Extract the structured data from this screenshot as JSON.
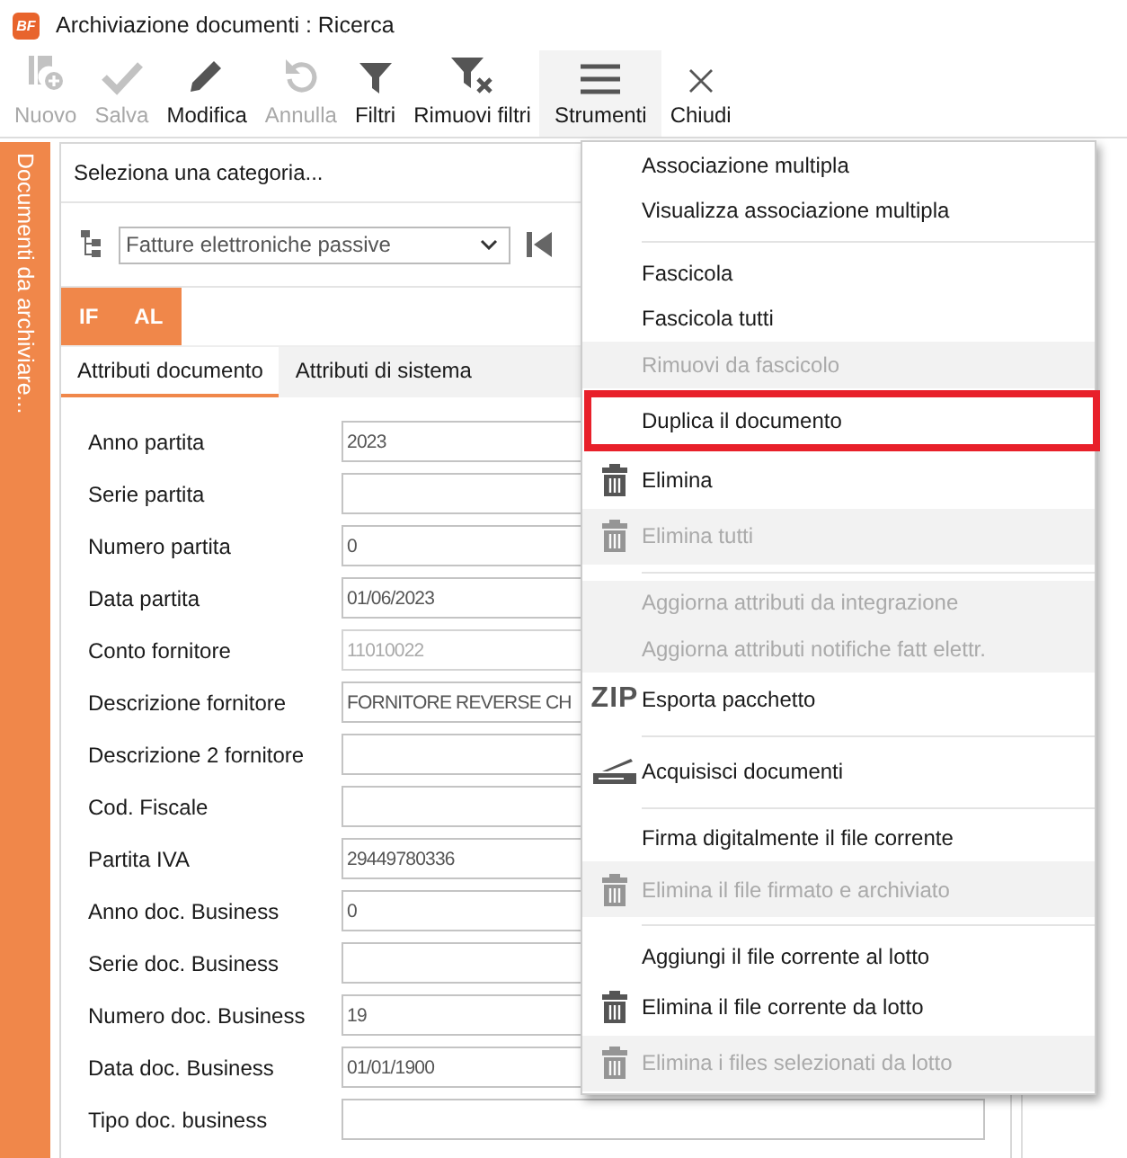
{
  "window": {
    "title": "Archiviazione documenti : Ricerca",
    "logo": "BF"
  },
  "toolbar": [
    {
      "label": "Nuovo",
      "kind": "new",
      "disabled": true,
      "selected": false
    },
    {
      "label": "Salva",
      "kind": "check",
      "disabled": true,
      "selected": false
    },
    {
      "label": "Modifica",
      "kind": "pencil",
      "disabled": false,
      "selected": false
    },
    {
      "label": "Annulla",
      "kind": "undo",
      "disabled": true,
      "selected": false
    },
    {
      "label": "Filtri",
      "kind": "filter",
      "disabled": false,
      "selected": false
    },
    {
      "label": "Rimuovi filtri",
      "kind": "filter-x",
      "disabled": false,
      "selected": false
    },
    {
      "label": "Strumenti",
      "kind": "menu",
      "disabled": false,
      "selected": true
    },
    {
      "label": "Chiudi",
      "kind": "close",
      "disabled": false,
      "selected": false
    }
  ],
  "side_panel": {
    "label": "Documenti da archiviare..."
  },
  "panel": {
    "header": "Seleziona una categoria...",
    "category": "Fatture elettroniche passive",
    "groups": [
      {
        "label": "IF"
      },
      {
        "label": "AL"
      }
    ],
    "tabs": [
      {
        "label": "Attributi documento",
        "selected": true
      },
      {
        "label": "Attributi di sistema",
        "selected": false
      }
    ],
    "fields": [
      {
        "label": "Anno partita",
        "value": "2023",
        "disabled": false
      },
      {
        "label": "Serie partita",
        "disabled": false
      },
      {
        "label": "Numero partita",
        "value": "0",
        "disabled": false
      },
      {
        "label": "Data partita",
        "value": "01/06/2023",
        "disabled": false
      },
      {
        "label": "Conto fornitore",
        "value": "11010022",
        "disabled": true
      },
      {
        "label": "Descrizione fornitore",
        "value": "FORNITORE REVERSE CH",
        "disabled": false
      },
      {
        "label": "Descrizione 2 fornitore",
        "disabled": false
      },
      {
        "label": "Cod. Fiscale",
        "disabled": false
      },
      {
        "label": "Partita IVA",
        "value": "29449780336",
        "disabled": false
      },
      {
        "label": "Anno doc. Business",
        "value": "0",
        "disabled": false
      },
      {
        "label": "Serie doc. Business",
        "disabled": false
      },
      {
        "label": "Numero doc. Business",
        "value": "19",
        "disabled": false
      },
      {
        "label": "Data doc. Business",
        "value": "01/01/1900",
        "disabled": false
      },
      {
        "label": "Tipo doc. business",
        "disabled": false
      }
    ]
  },
  "menu": [
    {
      "kind": "item",
      "label": "Associazione multipla",
      "disabled": false,
      "highlighted": false
    },
    {
      "kind": "item",
      "label": "Visualizza associazione multipla",
      "disabled": false,
      "highlighted": false
    },
    {
      "kind": "separator"
    },
    {
      "kind": "item",
      "label": "Fascicola",
      "disabled": false,
      "highlighted": false
    },
    {
      "kind": "item",
      "label": "Fascicola tutti",
      "disabled": false,
      "highlighted": false
    },
    {
      "kind": "item",
      "label": "Rimuovi da fascicolo",
      "disabled": true,
      "highlighted": false
    },
    {
      "kind": "item",
      "label": "Duplica il documento",
      "disabled": false,
      "highlighted": true
    },
    {
      "kind": "trash",
      "label": "Elimina",
      "disabled": false,
      "highlighted": false
    },
    {
      "kind": "trash",
      "label": "Elimina tutti",
      "disabled": true,
      "highlighted": false
    },
    {
      "kind": "separator"
    },
    {
      "kind": "item",
      "label": "Aggiorna attributi da integrazione",
      "disabled": true,
      "highlighted": false
    },
    {
      "kind": "item",
      "label": "Aggiorna attributi notifiche fatt elettr.",
      "disabled": true,
      "highlighted": false
    },
    {
      "kind": "zip",
      "label": "Esporta pacchetto",
      "icon_text": "ZIP",
      "disabled": false,
      "highlighted": false
    },
    {
      "kind": "separator"
    },
    {
      "kind": "scanner",
      "label": "Acquisisci documenti",
      "disabled": false,
      "highlighted": false
    },
    {
      "kind": "separator"
    },
    {
      "kind": "item",
      "label": "Firma digitalmente il file corrente",
      "disabled": false,
      "highlighted": false
    },
    {
      "kind": "trash",
      "label": "Elimina il file firmato e archiviato",
      "disabled": true,
      "highlighted": false
    },
    {
      "kind": "separator"
    },
    {
      "kind": "item",
      "label": "Aggiungi il file corrente al lotto",
      "disabled": false,
      "highlighted": false
    },
    {
      "kind": "trash",
      "label": "Elimina il file corrente da lotto",
      "disabled": false,
      "highlighted": false
    },
    {
      "kind": "trash",
      "label": "Elimina i files selezionati da lotto",
      "disabled": true,
      "highlighted": false
    }
  ]
}
